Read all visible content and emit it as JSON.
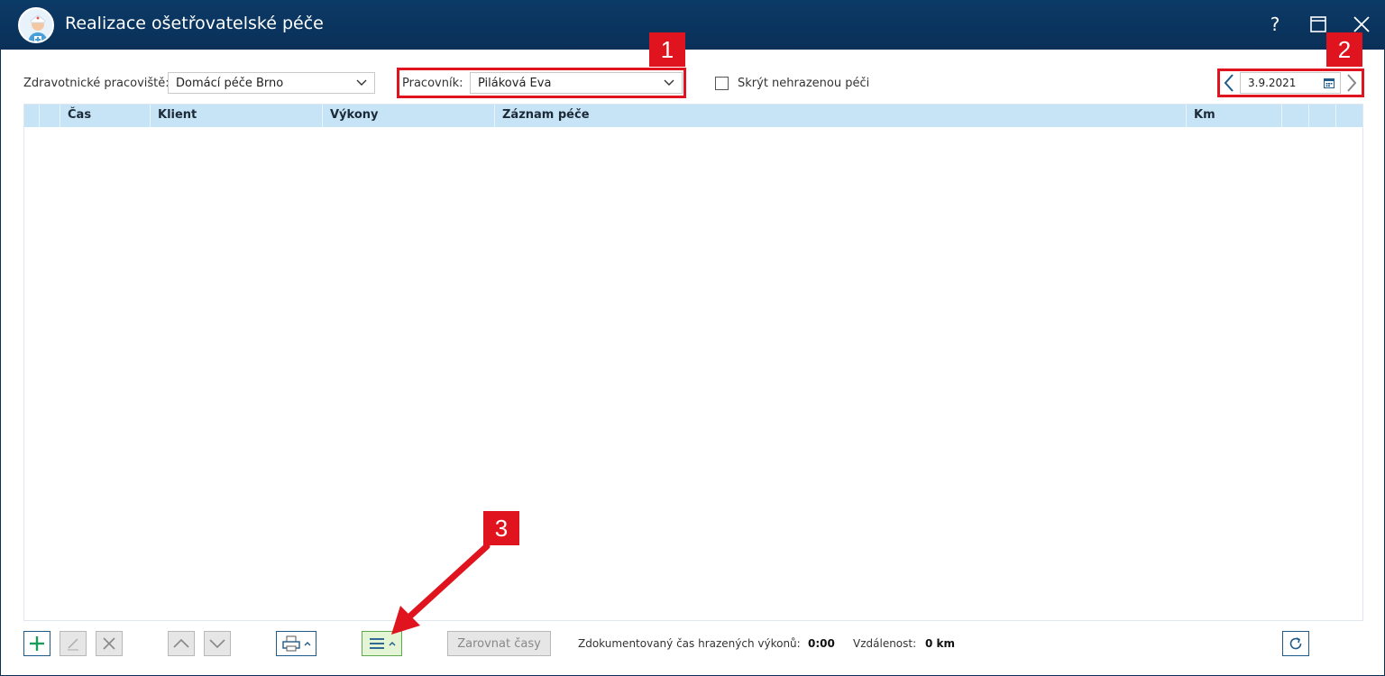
{
  "window": {
    "title": "Realizace ošetřovatelské péče",
    "help_label": "?"
  },
  "filters": {
    "workplace_label": "Zdravotnické pracoviště:",
    "workplace_value": "Domácí péče Brno",
    "worker_label": "Pracovník:",
    "worker_value": "Piláková Eva",
    "hide_unpaid_label": "Skrýt nehrazenou péči",
    "hide_unpaid_checked": false,
    "date_value": "3.9.2021"
  },
  "annotations": {
    "badge_1": "1",
    "badge_2": "2",
    "badge_3": "3",
    "highlight_color": "#e0141e"
  },
  "grid": {
    "columns": [
      "Čas",
      "Klient",
      "Výkony",
      "Záznam péče",
      "Km"
    ],
    "rows": []
  },
  "toolbar": {
    "align_times_label": "Zarovnat časy",
    "documented_time_label": "Zdokumentovaný čas hrazených výkonů:",
    "documented_time_value": "0:00",
    "distance_label": "Vzdálenost:",
    "distance_value": "0 km"
  },
  "icons": {
    "app": "nurse-icon",
    "add": "plus-icon",
    "edit": "pencil-icon",
    "delete": "cross-icon",
    "up": "chevron-up-icon",
    "down": "chevron-down-icon",
    "print": "printer-icon",
    "menu": "hamburger-icon",
    "refresh": "refresh-icon",
    "calendar": "calendar-icon"
  },
  "colors": {
    "titlebar": "#0b3a66",
    "grid_header": "#c6e4f6",
    "accent_blue": "#1e5b8a",
    "menu_green": "#e4f5d6",
    "annotation_red": "#e0141e"
  }
}
